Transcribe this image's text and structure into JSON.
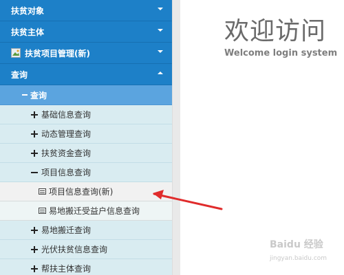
{
  "sidebar": {
    "top_items": [
      {
        "label": "扶贫对象",
        "icon": "chevron-down-icon"
      },
      {
        "label": "扶贫主体",
        "icon": "chevron-down-icon"
      },
      {
        "label": "扶贫项目管理(新)",
        "icon": "chevron-down-icon"
      },
      {
        "label": "查询",
        "icon": "chevron-up-icon"
      }
    ],
    "sub_header": {
      "label": "查询"
    },
    "rows": [
      {
        "label": "基础信息查询",
        "icon": "plus-icon"
      },
      {
        "label": "动态管理查询",
        "icon": "plus-icon"
      },
      {
        "label": "扶贫资金查询",
        "icon": "plus-icon"
      },
      {
        "label": "项目信息查询",
        "icon": "minus-icon"
      },
      {
        "label": "项目信息查询(新)",
        "icon": "document-icon"
      },
      {
        "label": "易地搬迁受益户信息查询",
        "icon": "document-icon"
      },
      {
        "label": "易地搬迁查询",
        "icon": "plus-icon"
      },
      {
        "label": "光伏扶贫信息查询",
        "icon": "plus-icon"
      },
      {
        "label": "帮扶主体查询",
        "icon": "plus-icon"
      }
    ]
  },
  "welcome": {
    "title": "欢迎访问",
    "subtitle": "Welcome login system"
  },
  "colors": {
    "menu_blue": "#1d80c8",
    "sub_header_blue": "#5ba4df",
    "row_bg": "#d9ecf1",
    "arrow_red": "#e02b2b"
  }
}
